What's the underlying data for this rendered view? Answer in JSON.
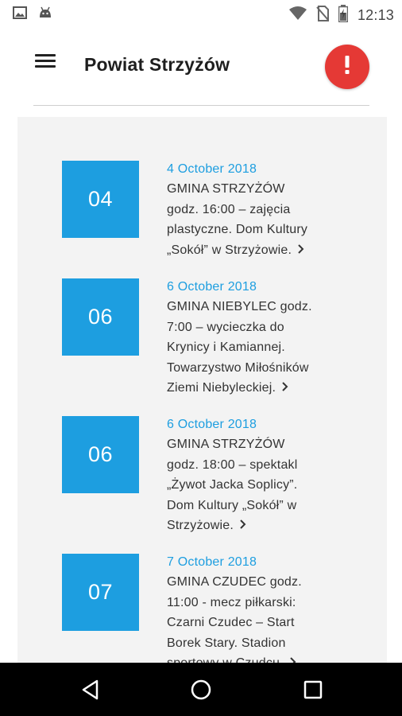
{
  "status_bar": {
    "time": "12:13",
    "icons": [
      "image-icon",
      "android-icon",
      "wifi-icon",
      "no-sim-icon",
      "battery-charging-icon"
    ]
  },
  "header": {
    "title": "Powiat Strzyżów",
    "alert_icon": "alert-icon",
    "menu_icon": "menu-icon"
  },
  "events": [
    {
      "day": "04",
      "date": "4 October 2018",
      "lines": [
        "GMINA STRZYŻÓW",
        "godz. 16:00 – zajęcia",
        "plastyczne. Dom Kultury",
        "„Sokół” w Strzyżowie."
      ]
    },
    {
      "day": "06",
      "date": "6 October 2018",
      "lines": [
        "GMINA NIEBYLEC godz.",
        "7:00 – wycieczka do",
        "Krynicy i Kamiannej.",
        "Towarzystwo Miłośników",
        "Ziemi Niebyleckiej."
      ]
    },
    {
      "day": "06",
      "date": "6 October 2018",
      "lines": [
        "GMINA STRZYŻÓW",
        "godz. 18:00 – spektakl",
        "„Żywot Jacka Soplicy”.",
        "Dom Kultury „Sokół” w",
        "Strzyżowie."
      ]
    },
    {
      "day": "07",
      "date": "7 October 2018",
      "lines": [
        "GMINA CZUDEC godz.",
        "11:00 - mecz piłkarski:",
        "Czarni Czudec – Start",
        "Borek Stary. Stadion",
        "sportowy w Czudcu."
      ]
    }
  ],
  "nav_bar": {
    "back_icon": "back-icon",
    "home_icon": "home-icon",
    "recents_icon": "recents-icon"
  },
  "colors": {
    "accent": "#1d9ee0",
    "alert": "#e53935",
    "content_bg": "#f3f3f3"
  }
}
